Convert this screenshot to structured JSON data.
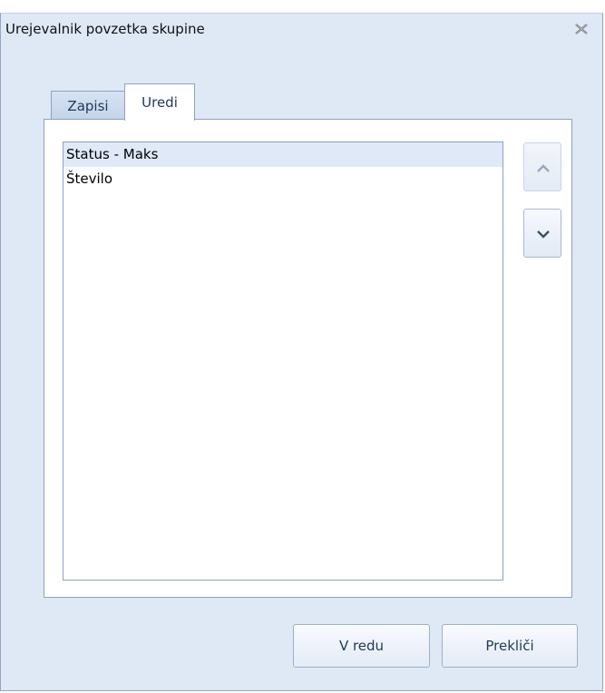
{
  "window": {
    "title": "Urejevalnik povzetka skupine"
  },
  "icons": {
    "close": "close-icon",
    "up": "chevron-up-icon",
    "down": "chevron-down-icon"
  },
  "tabs": [
    {
      "label": "Zapisi",
      "active": false
    },
    {
      "label": "Uredi",
      "active": true
    }
  ],
  "list": {
    "items": [
      {
        "label": "Status - Maks",
        "selected": true
      },
      {
        "label": "Število",
        "selected": false
      }
    ]
  },
  "buttons": {
    "ok": "V redu",
    "cancel": "Prekliči"
  },
  "colors": {
    "dialog_bg": "#dfe8f5",
    "border": "#8da2bf",
    "selection": "#dfe9f8",
    "text_accent": "#1e395b"
  }
}
